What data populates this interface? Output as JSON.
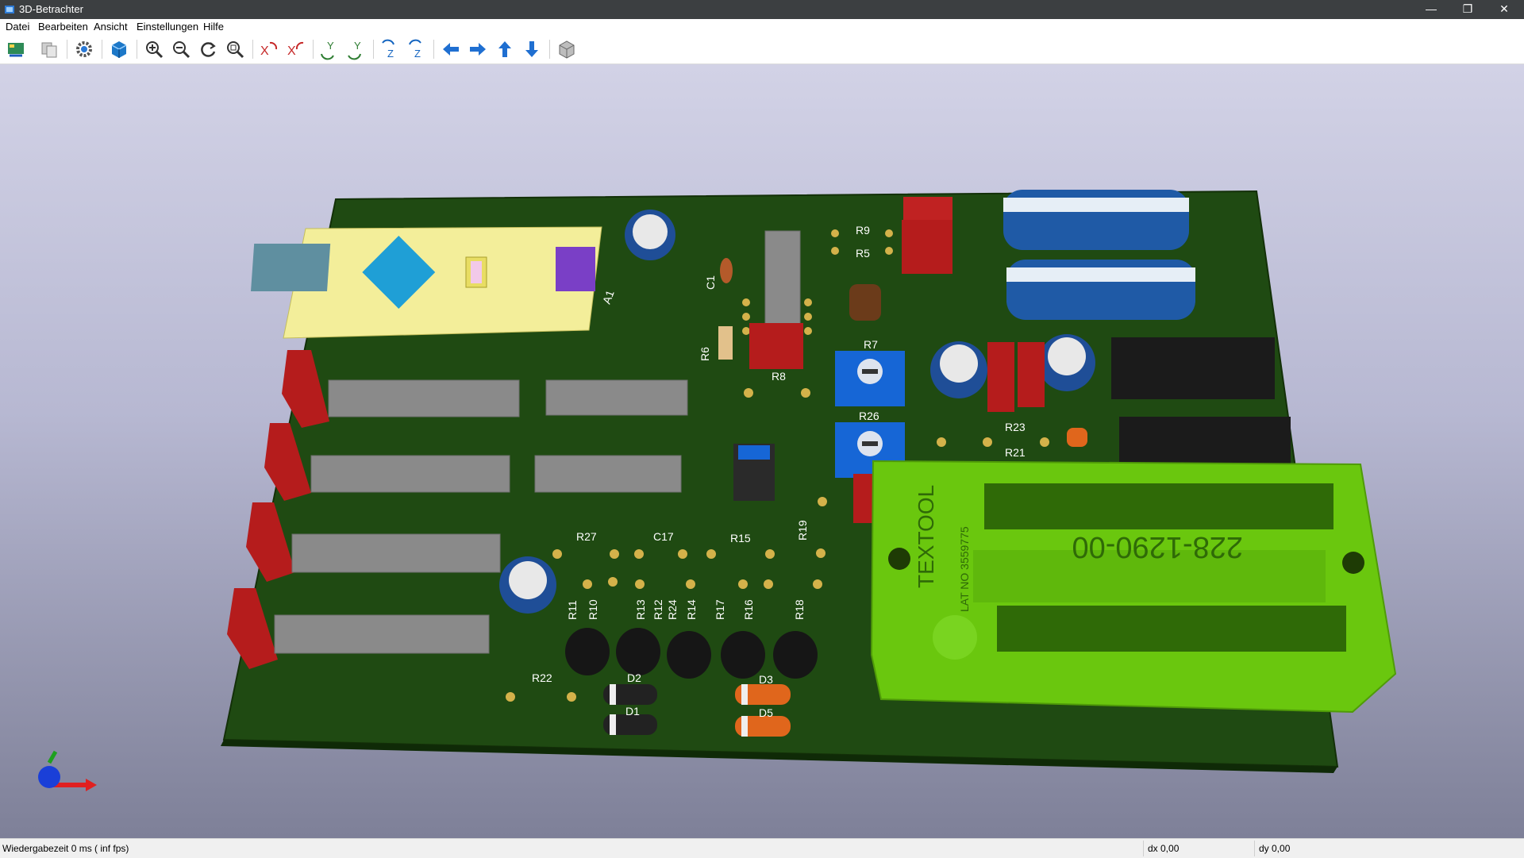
{
  "window": {
    "title": "3D-Betrachter",
    "minimize": "—",
    "restore": "❐",
    "close": "✕"
  },
  "menu": [
    "Datei",
    "Bearbeiten",
    "Ansicht",
    "Einstellungen",
    "Hilfe"
  ],
  "toolbar_icons": [
    "reload-board-icon",
    "copy-image-icon",
    "settings-gear-icon",
    "render-mode-cube-icon",
    "zoom-in-icon",
    "zoom-out-icon",
    "redraw-icon",
    "zoom-fit-icon",
    "rotate-x-cw-icon",
    "rotate-x-ccw-icon",
    "rotate-y-cw-icon",
    "rotate-y-ccw-icon",
    "rotate-z-cw-icon",
    "rotate-z-ccw-icon",
    "move-left-icon",
    "move-right-icon",
    "move-up-icon",
    "move-down-icon",
    "orthographic-icon"
  ],
  "board": {
    "colors": {
      "soldermask": "#1f4a12",
      "pad": "#d4b24a",
      "ic_body": "#8a8a8a",
      "zif": "#6ac70e",
      "cap_blue": "#1f4e97"
    },
    "labels": {
      "R9": "R9",
      "R5": "R5",
      "C1": "C1",
      "A1": "A1",
      "R6": "R6",
      "R8": "R8",
      "R7": "R7",
      "R26": "R26",
      "R23": "R23",
      "R21": "R21",
      "R27": "R27",
      "C17": "C17",
      "R15": "R15",
      "R19": "R19",
      "R11": "R11",
      "R10": "R10",
      "R13": "R13",
      "R12": "R12",
      "R24": "R24",
      "R14": "R14",
      "R17": "R17",
      "R16": "R16",
      "R18": "R18",
      "R22": "R22",
      "D2": "D2",
      "D1": "D1",
      "D3": "D3",
      "D5": "D5"
    },
    "zif_part": "228-1290-00",
    "zif_brand": "TEXTOOL",
    "zif_sub": "LAT NO 3559775"
  },
  "status": {
    "render_time": "Wiedergabezeit 0 ms ( inf fps)",
    "dx": "dx 0,00",
    "dy": "dy 0,00"
  }
}
